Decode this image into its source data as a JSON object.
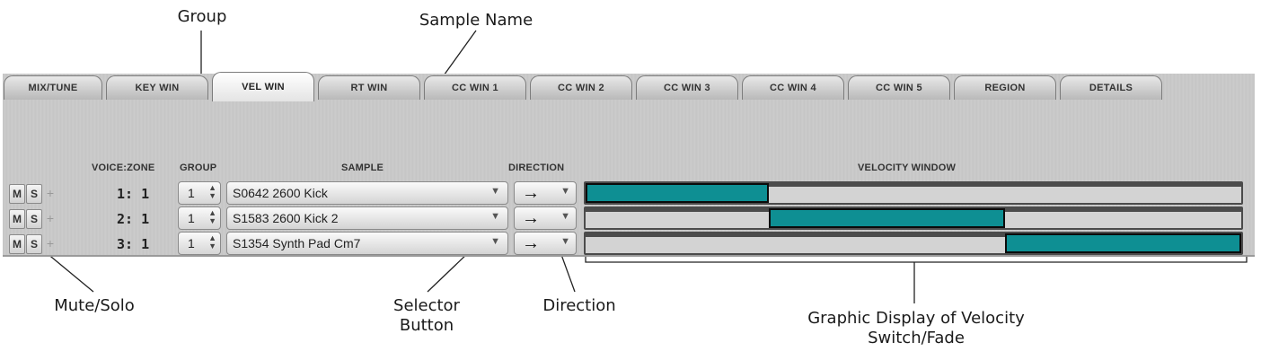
{
  "annotations": {
    "group": "Group",
    "sample_name": "Sample Name",
    "mute_solo": "Mute/Solo",
    "selector_button": "Selector Button",
    "direction": "Direction",
    "velocity_graphic_line1": "Graphic Display of Velocity",
    "velocity_graphic_line2": "Switch/Fade"
  },
  "tabs": [
    {
      "label": "MIX/TUNE",
      "active": false
    },
    {
      "label": "KEY WIN",
      "active": false
    },
    {
      "label": "VEL WIN",
      "active": true
    },
    {
      "label": "RT WIN",
      "active": false
    },
    {
      "label": "CC WIN 1",
      "active": false
    },
    {
      "label": "CC WIN 2",
      "active": false
    },
    {
      "label": "CC WIN 3",
      "active": false
    },
    {
      "label": "CC WIN 4",
      "active": false
    },
    {
      "label": "CC WIN 5",
      "active": false
    },
    {
      "label": "REGION",
      "active": false
    },
    {
      "label": "DETAILS",
      "active": false
    }
  ],
  "columns": {
    "voice_zone": "VOICE:ZONE",
    "group": "GROUP",
    "sample": "SAMPLE",
    "direction": "DIRECTION",
    "velocity_window": "VELOCITY WINDOW"
  },
  "buttons": {
    "mute": "M",
    "solo": "S",
    "add": "+"
  },
  "rows": [
    {
      "voice_zone": "1: 1",
      "group": "1",
      "sample": "S0642 2600 Kick",
      "direction": "→",
      "velocity_window": {
        "start_fraction": 0.0,
        "end_fraction": 0.28
      }
    },
    {
      "voice_zone": "2: 1",
      "group": "1",
      "sample": "S1583 2600 Kick 2",
      "direction": "→",
      "velocity_window": {
        "start_fraction": 0.28,
        "end_fraction": 0.64
      }
    },
    {
      "voice_zone": "3: 1",
      "group": "1",
      "sample": "S1354 Synth Pad Cm7",
      "direction": "→",
      "velocity_window": {
        "start_fraction": 0.64,
        "end_fraction": 1.0
      }
    }
  ],
  "colors": {
    "velocity_fill": "#0e8f93",
    "velocity_track": "#d3d3d3"
  },
  "icons": {
    "dropdown": "triangle-down-icon",
    "spinner": "up-down-spinner-icon",
    "direction_arrow": "right-arrow-icon"
  }
}
